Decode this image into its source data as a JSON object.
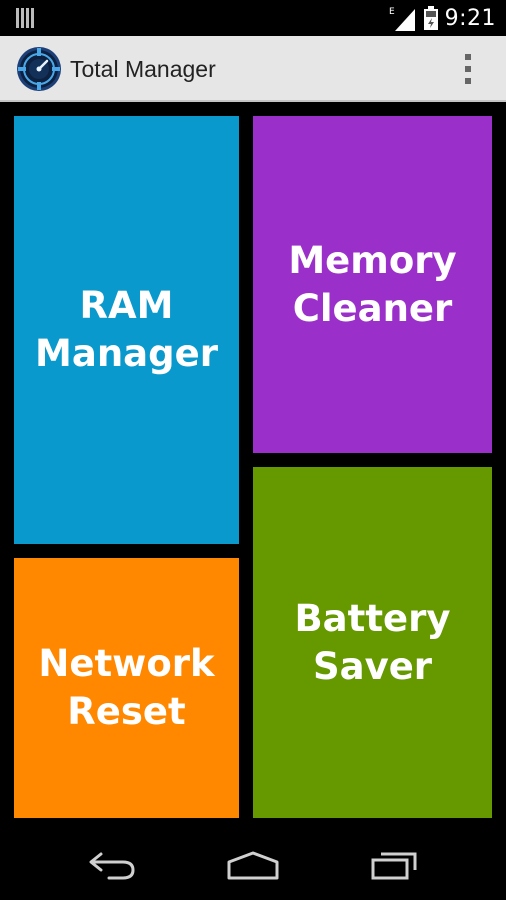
{
  "status_bar": {
    "time": "9:21",
    "network_type": "E",
    "icons": [
      "notification-icon",
      "signal-icon",
      "battery-icon"
    ]
  },
  "action_bar": {
    "title": "Total Manager",
    "logo_icon": "app-logo-icon",
    "menu_icon": "overflow-menu-icon"
  },
  "tiles": {
    "ram": {
      "label": "RAM\nManager",
      "color": "#0a99cc"
    },
    "memory": {
      "label": "Memory\nCleaner",
      "color": "#9b2fc9"
    },
    "network": {
      "label": "Network\nReset",
      "color": "#ff8800"
    },
    "battery": {
      "label": "Battery\nSaver",
      "color": "#669900"
    }
  },
  "nav_bar": {
    "icons": [
      "back-icon",
      "home-icon",
      "recents-icon"
    ]
  },
  "colors": {
    "background": "#000000",
    "action_bar": "#e6e6e6",
    "nav_icon": "#d0d0d0"
  }
}
